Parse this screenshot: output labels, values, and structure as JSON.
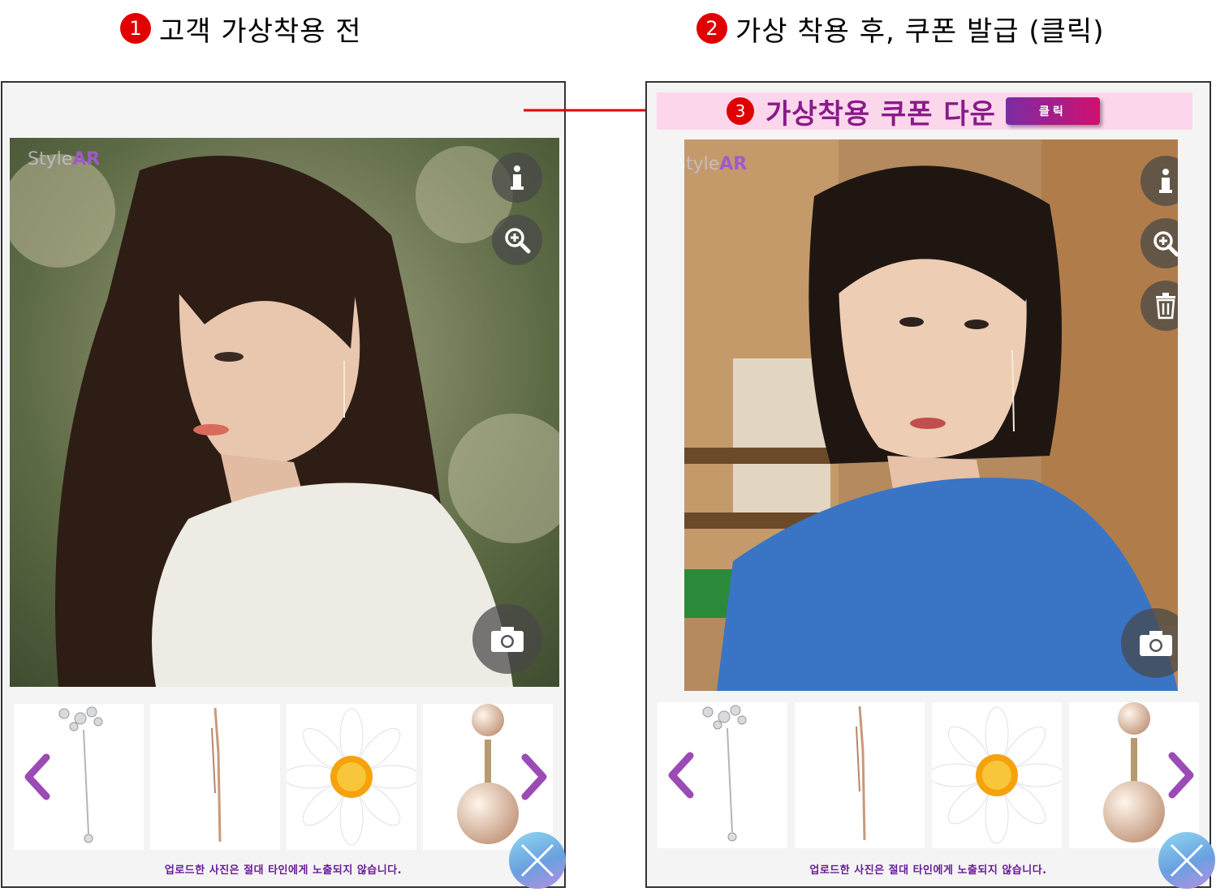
{
  "headings": {
    "left": {
      "number": "1",
      "text": "고객 가상착용 전"
    },
    "right": {
      "number": "2",
      "text": "가상 착용 후, 쿠폰 발급 (클릭)"
    }
  },
  "coupon": {
    "number": "3",
    "text": "가상착용 쿠폰 다운",
    "button_label": "클릭"
  },
  "watermark": {
    "prefix": "Style",
    "suffix": "AR"
  },
  "notice": "업로드한 사진은 절대 타인에게 노출되지 않습니다.",
  "icons": [
    "info-icon",
    "zoom-in-icon",
    "trash-icon",
    "camera-icon",
    "chevron-left-icon",
    "chevron-right-icon",
    "close-icon"
  ],
  "thumbnails": [
    "crystal-flower-drop-earring",
    "gold-chain-earring",
    "daisy-earring",
    "pearl-drop-earring"
  ],
  "colors": {
    "accent": "#8b1a8a",
    "nav_arrow": "#9b4bb5",
    "coupon_bar": "#fcd7ec",
    "marker": "#e00000"
  }
}
